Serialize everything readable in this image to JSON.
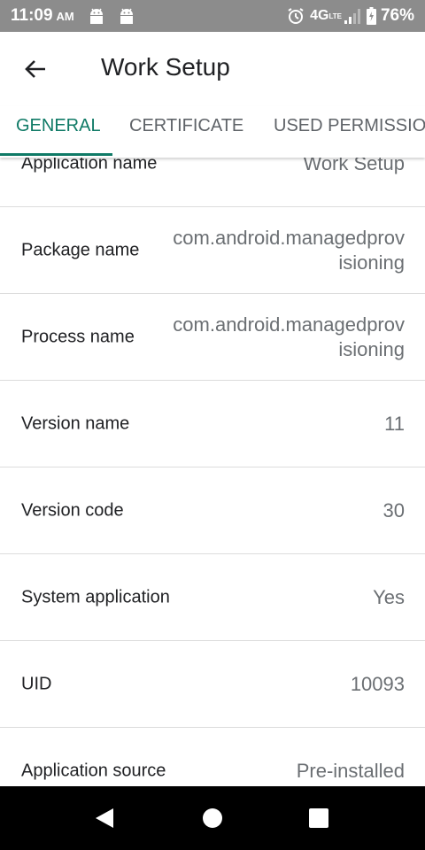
{
  "status_bar": {
    "time": "11:09",
    "ampm": "AM",
    "network": "4G",
    "network_sub": "LTE",
    "battery": "76%"
  },
  "app_bar": {
    "title": "Work Setup"
  },
  "tabs": [
    {
      "label": "GENERAL",
      "active": true
    },
    {
      "label": "CERTIFICATE",
      "active": false
    },
    {
      "label": "USED PERMISSIONS",
      "active": false
    }
  ],
  "details": [
    {
      "label": "Application name",
      "value": "Work Setup"
    },
    {
      "label": "Package name",
      "value": "com.android.managedprovisioning"
    },
    {
      "label": "Process name",
      "value": "com.android.managedprovisioning"
    },
    {
      "label": "Version name",
      "value": "11"
    },
    {
      "label": "Version code",
      "value": "30"
    },
    {
      "label": "System application",
      "value": "Yes"
    },
    {
      "label": "UID",
      "value": "10093"
    },
    {
      "label": "Application source",
      "value": "Pre-installed"
    }
  ],
  "colors": {
    "accent": "#0f7a66",
    "status_bar": "#8c8c8c",
    "divider": "#dcdcdc",
    "nav_bar": "#000000"
  },
  "icons": {
    "back": "arrow-left",
    "nav_back": "triangle-left",
    "nav_home": "circle",
    "nav_recents": "square"
  }
}
